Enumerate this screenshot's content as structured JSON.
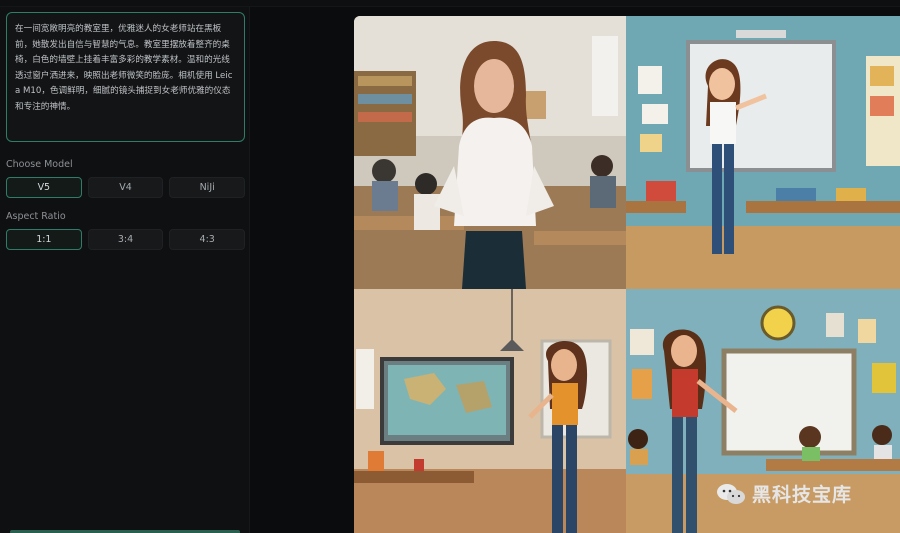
{
  "prompt": {
    "text": "在一间宽敞明亮的教室里，优雅迷人的女老师站在黑板前，她散发出自信与智慧的气息。教室里摆放着整齐的桌椅，白色的墙壁上挂着丰富多彩的教学素材。温和的光线透过窗户洒进来，映照出老师微笑的脸庞。相机使用 Leica M10，色调鲜明，细腻的镜头捕捉到女老师优雅的仪态和专注的神情。"
  },
  "model": {
    "label": "Choose Model",
    "options": [
      "V5",
      "V4",
      "NiJi"
    ],
    "selected": "V5"
  },
  "aspect": {
    "label": "Aspect Ratio",
    "options": [
      "1:1",
      "3:4",
      "4:3"
    ],
    "selected": "1:1"
  },
  "gallery": {
    "images": [
      {
        "icon": "photo-teacher-realistic"
      },
      {
        "icon": "illustration-teacher-whiteboard"
      },
      {
        "icon": "illustration-teacher-map"
      },
      {
        "icon": "illustration-teacher-classroom"
      }
    ]
  },
  "watermark": {
    "text": "黑科技宝库",
    "icon": "wechat-icon"
  },
  "colors": {
    "accent": "#2f7d68",
    "background": "#0b0c0d",
    "panel": "#0f1011"
  }
}
